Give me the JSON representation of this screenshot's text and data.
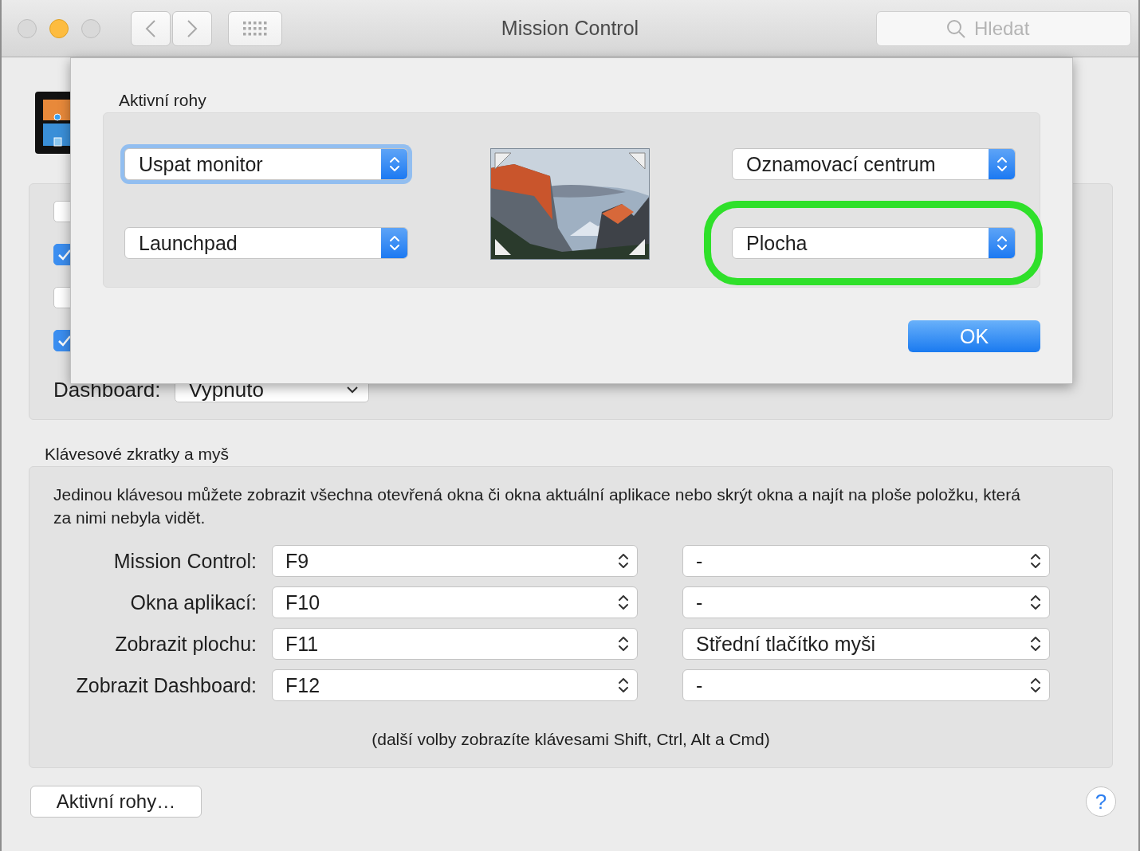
{
  "window": {
    "title": "Mission Control",
    "search": {
      "placeholder": "Hledat"
    }
  },
  "general": {
    "checkboxes": [
      {
        "checked": false
      },
      {
        "checked": true
      },
      {
        "checked": false
      },
      {
        "checked": true
      }
    ],
    "dashboard": {
      "label": "Dashboard:",
      "value": "Vypnuto"
    }
  },
  "shortcuts": {
    "title": "Klávesové zkratky a myš",
    "description": "Jedinou klávesou můžete zobrazit všechna otevřená okna či okna aktuální aplikace nebo skrýt okna a najít na ploše položku, která za nimi nebyla vidět.",
    "rows": [
      {
        "label": "Mission Control:",
        "keyboard": "F9",
        "mouse": "-"
      },
      {
        "label": "Okna aplikací:",
        "keyboard": "F10",
        "mouse": "-"
      },
      {
        "label": "Zobrazit plochu:",
        "keyboard": "F11",
        "mouse": "Střední tlačítko myši"
      },
      {
        "label": "Zobrazit Dashboard:",
        "keyboard": "F12",
        "mouse": "-"
      }
    ],
    "note": "(další volby zobrazíte klávesami Shift, Ctrl, Alt a Cmd)"
  },
  "hot_corners_button": "Aktivní rohy…",
  "help": "?",
  "sheet": {
    "title": "Aktivní rohy",
    "corners": [
      {
        "value": "Uspat monitor",
        "focused": true,
        "highlighted": false
      },
      {
        "value": "Launchpad",
        "focused": false,
        "highlighted": false
      },
      {
        "value": "Oznamovací centrum",
        "focused": false,
        "highlighted": false
      },
      {
        "value": "Plocha",
        "focused": false,
        "highlighted": true
      }
    ],
    "ok": "OK"
  }
}
